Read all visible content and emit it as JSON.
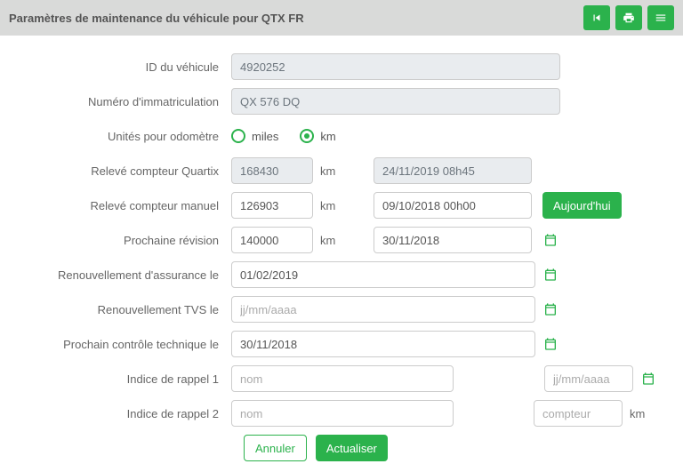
{
  "header": {
    "title": "Paramètres de maintenance du véhicule pour QTX FR"
  },
  "labels": {
    "vehicle_id": "ID du véhicule",
    "registration": "Numéro d'immatriculation",
    "odo_units": "Unités pour odomètre",
    "quartix_reading": "Relevé compteur Quartix",
    "manual_reading": "Relevé compteur manuel",
    "next_service": "Prochaine révision",
    "insurance_renewal": "Renouvellement d'assurance le",
    "tvs_renewal": "Renouvellement TVS le",
    "next_inspection": "Prochain contrôle technique le",
    "reminder1": "Indice de rappel 1",
    "reminder2": "Indice de rappel 2",
    "unit_km": "km",
    "miles": "miles",
    "km": "km"
  },
  "values": {
    "vehicle_id": "4920252",
    "registration": "QX 576 DQ",
    "quartix_odo": "168430",
    "quartix_date": "24/11/2019 08h45",
    "manual_odo": "126903",
    "manual_date": "09/10/2018 00h00",
    "next_service_odo": "140000",
    "next_service_date": "30/11/2018",
    "insurance_date": "01/02/2019",
    "tvs_date": "",
    "inspection_date": "30/11/2018",
    "r1_name": "",
    "r1_date": "",
    "r2_name": "",
    "r2_counter": ""
  },
  "placeholders": {
    "date": "jj/mm/aaaa",
    "name": "nom",
    "counter": "compteur"
  },
  "buttons": {
    "today": "Aujourd'hui",
    "cancel": "Annuler",
    "update": "Actualiser"
  },
  "odo_unit_selected": "km"
}
